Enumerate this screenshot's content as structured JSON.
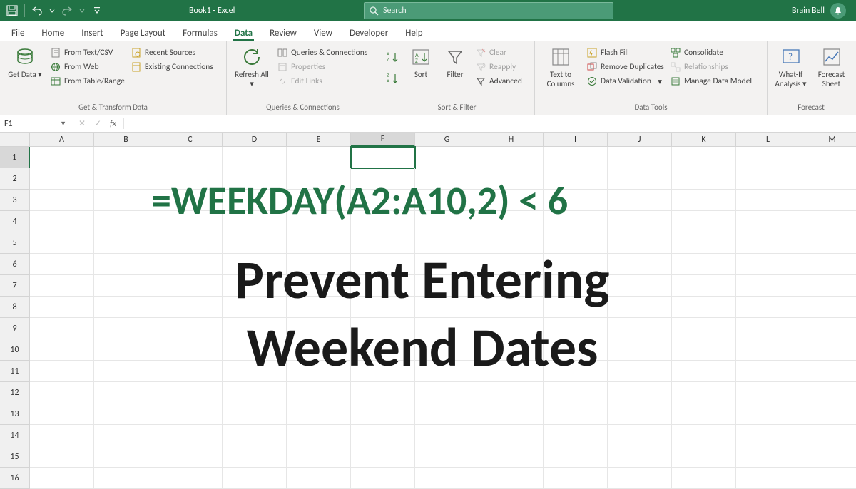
{
  "title_bar": {
    "doc_title": "Book1  -  Excel",
    "search_placeholder": "Search",
    "user_name": "Brain Bell"
  },
  "tabs": {
    "file": "File",
    "home": "Home",
    "insert": "Insert",
    "page_layout": "Page Layout",
    "formulas": "Formulas",
    "data": "Data",
    "review": "Review",
    "view": "View",
    "developer": "Developer",
    "help": "Help"
  },
  "ribbon": {
    "transform": {
      "get_data": "Get\nData",
      "from_text": "From Text/CSV",
      "from_web": "From Web",
      "from_table": "From Table/Range",
      "recent": "Recent Sources",
      "existing": "Existing Connections",
      "label": "Get & Transform Data"
    },
    "queries": {
      "refresh": "Refresh\nAll",
      "qc": "Queries & Connections",
      "props": "Properties",
      "edit_links": "Edit Links",
      "label": "Queries & Connections"
    },
    "sortfilter": {
      "sort": "Sort",
      "filter": "Filter",
      "clear": "Clear",
      "reapply": "Reapply",
      "advanced": "Advanced",
      "label": "Sort & Filter"
    },
    "datatools": {
      "ttc": "Text to\nColumns",
      "flash": "Flash Fill",
      "dup": "Remove Duplicates",
      "validation": "Data Validation",
      "consolidate": "Consolidate",
      "relationships": "Relationships",
      "dmodel": "Manage Data Model",
      "label": "Data Tools"
    },
    "forecast": {
      "whatif": "What-If\nAnalysis",
      "sheet": "Forecast\nSheet",
      "label": "Forecast"
    }
  },
  "formula_bar": {
    "cell_ref": "F1",
    "formula": ""
  },
  "columns": [
    "A",
    "B",
    "C",
    "D",
    "E",
    "F",
    "G",
    "H",
    "I",
    "J",
    "K",
    "L",
    "M"
  ],
  "rows": [
    "1",
    "2",
    "3",
    "4",
    "5",
    "6",
    "7",
    "8",
    "9",
    "10",
    "11",
    "12",
    "13",
    "14",
    "15",
    "16"
  ],
  "selected_cell": "F1",
  "overlay": {
    "formula": "=WEEKDAY(A2:A10,2) < 6",
    "heading_line1": "Prevent Entering",
    "heading_line2": "Weekend Dates"
  }
}
